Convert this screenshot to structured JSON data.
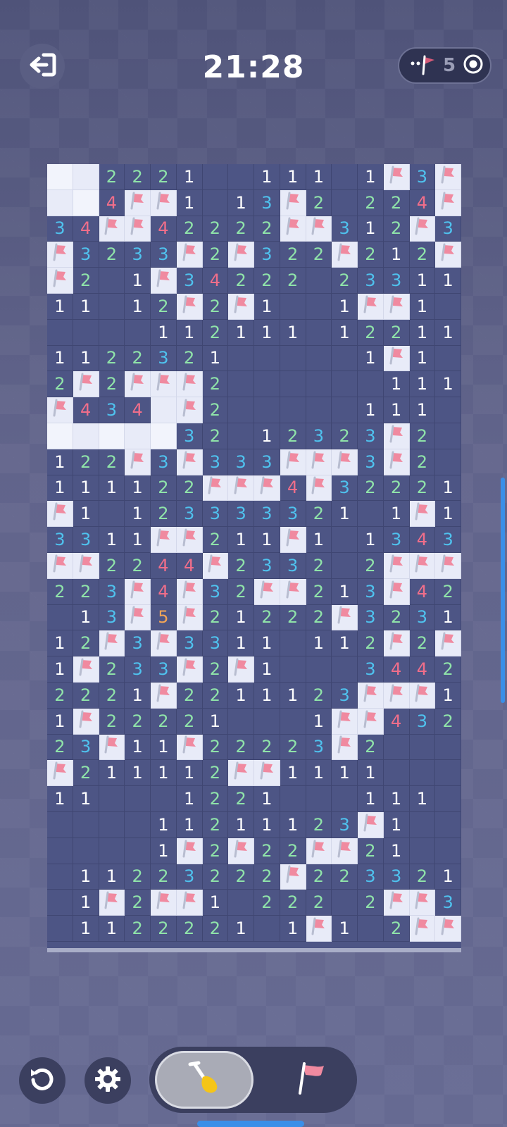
{
  "header": {
    "timer": "21:28",
    "mines_remaining": "5",
    "exit_icon": "exit-icon",
    "flag_counter_icon": "flag-icon",
    "target_icon": "target-icon"
  },
  "colors": {
    "background": "#5b5f86",
    "board": "#4d5585",
    "covered_cell": "#e8ebf8",
    "number_1": "#ffffff",
    "number_2": "#8fe3a9",
    "number_3": "#4fc2ee",
    "number_4": "#f06e8a",
    "number_5": "#f3a557",
    "flag": "#f08aa0",
    "accent": "#3a8fe8"
  },
  "board": {
    "cols": 16,
    "rows": 30,
    "legend": "C = covered, F = flagged, . = empty revealed, digit = adjacent mines",
    "cells": [
      "CC2221..111.1F3F",
      "CC4FF1.13F2.224F",
      "34FF42222FF312F32",
      "F3233F2F322F212F",
      "F2.1F34222.23311",
      "11.12F2F1..1FF1.",
      "....112111.12211",
      "112232 1.....1F1",
      "2F2FFF2......111",
      "F434CF2.....111.",
      "CCCCC32.12323F2.",
      "122F3F333FFF3F2.",
      "11112 2FFF4F3222 1",
      "F1.1233333 21.1F1",
      "3311FF211F1.1343",
      "FF2244F2332.2FFF",
      "223F4F32FF213F42",
      ".13F5F2122 2F3231",
      "12F3F3311.112F2F",
      "1F233F2F1...3442",
      "2221F2211123FFF1",
      "1F22221...1FF4321",
      "23F11F22223F2...",
      "F211112FF1111...",
      "11...1221...111.",
      "....11211123F1..",
      "....1F2F22FF21..",
      ".11223222F223321",
      ".1F2FF1.222.2FF3",
      ".1122221.1F1.2FFF"
    ]
  },
  "controls": {
    "restart_icon": "restart-icon",
    "settings_icon": "gear-icon",
    "dig_mode_icon": "shovel-icon",
    "flag_mode_icon": "flag-icon",
    "active_mode": "dig"
  }
}
